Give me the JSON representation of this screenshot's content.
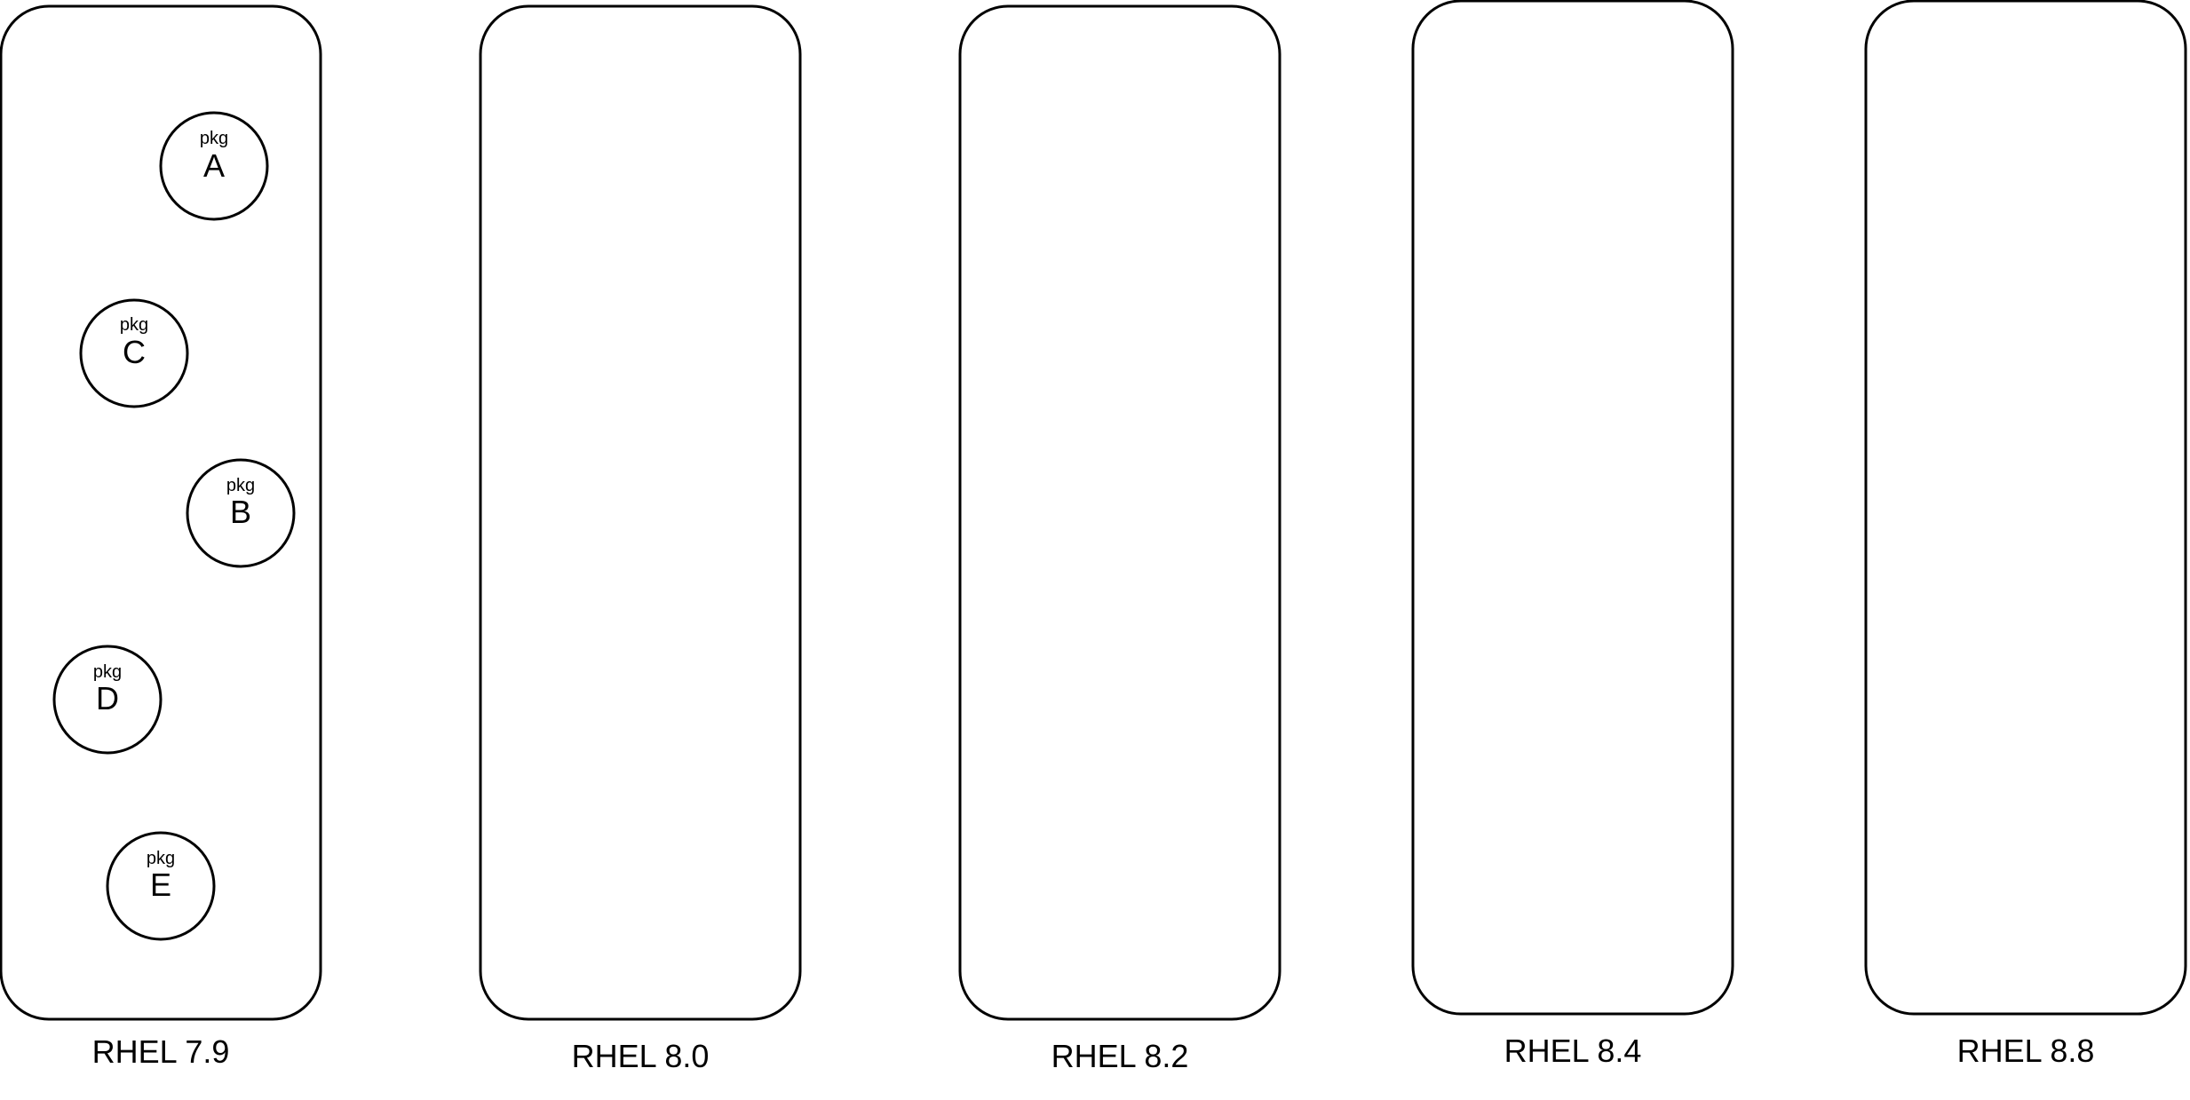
{
  "diagram": {
    "stroke_color": "#000000",
    "fill_color": "#ffffff",
    "releases": [
      {
        "label": "RHEL 7.9",
        "packages": [
          {
            "prefix": "pkg",
            "name": "A"
          },
          {
            "prefix": "pkg",
            "name": "C"
          },
          {
            "prefix": "pkg",
            "name": "B"
          },
          {
            "prefix": "pkg",
            "name": "D"
          },
          {
            "prefix": "pkg",
            "name": "E"
          }
        ]
      },
      {
        "label": "RHEL 8.0",
        "packages": []
      },
      {
        "label": "RHEL 8.2",
        "packages": []
      },
      {
        "label": "RHEL 8.4",
        "packages": []
      },
      {
        "label": "RHEL 8.8",
        "packages": []
      }
    ]
  }
}
